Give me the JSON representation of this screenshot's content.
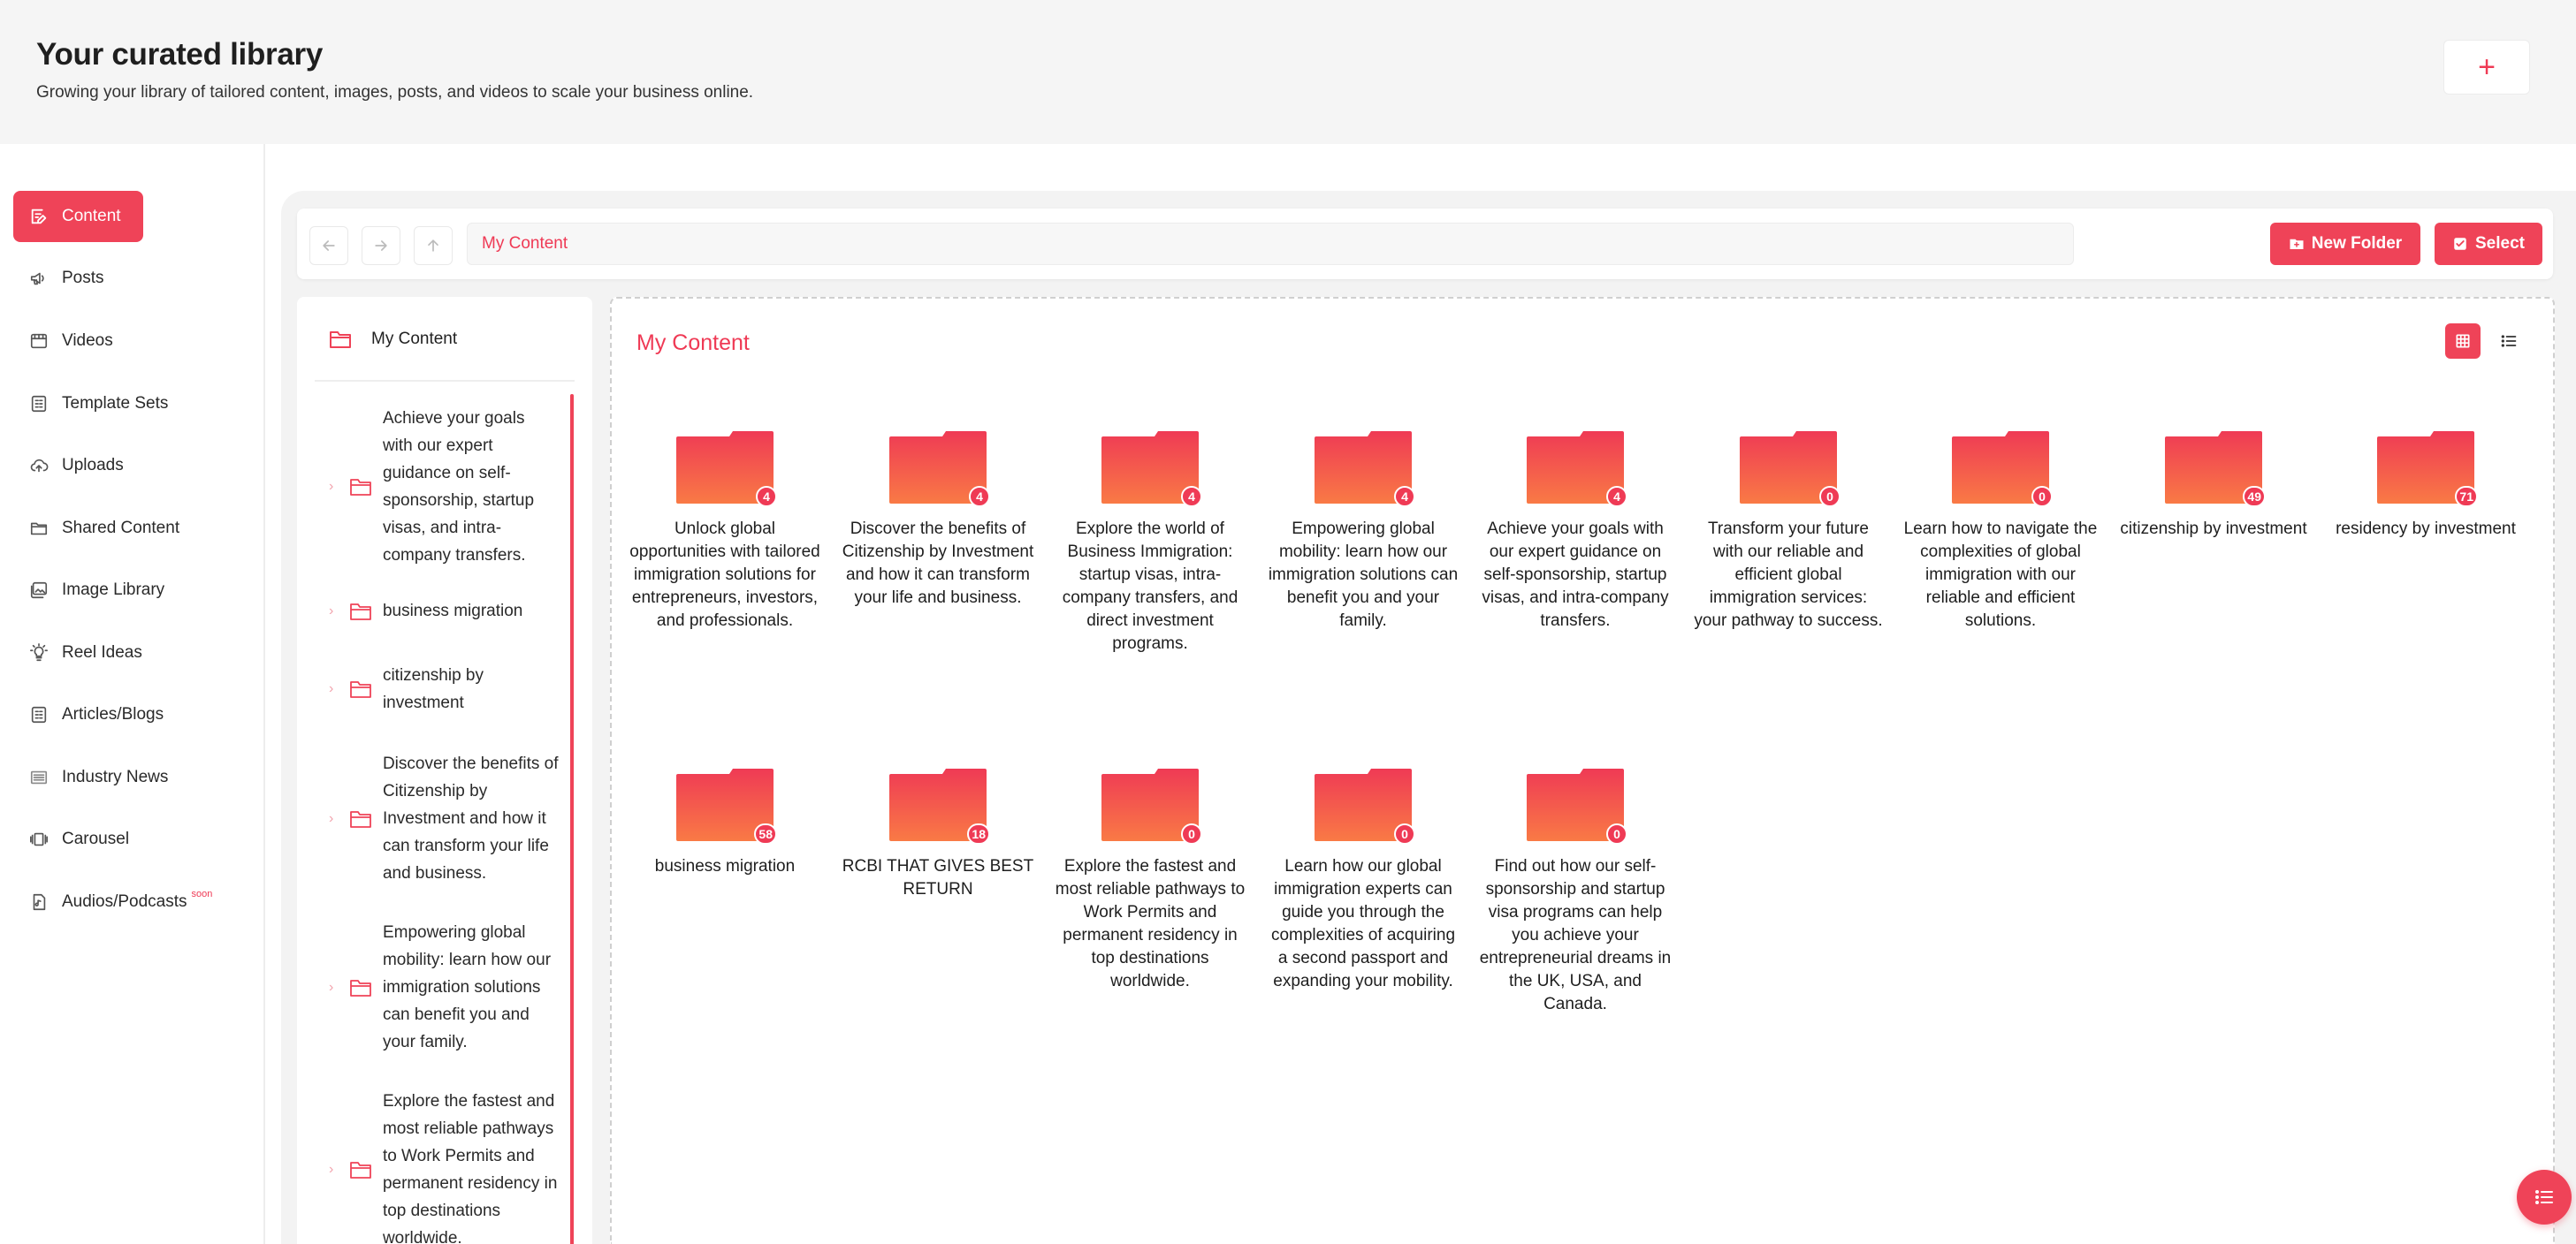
{
  "header": {
    "title": "Your curated library",
    "subtitle": "Growing your library of tailored content, images, posts, and videos to scale your business online.",
    "add_label": "+"
  },
  "sidebar": {
    "items": [
      {
        "label": "Content",
        "icon": "content-icon",
        "active": true
      },
      {
        "label": "Posts",
        "icon": "megaphone-icon"
      },
      {
        "label": "Videos",
        "icon": "video-icon"
      },
      {
        "label": "Template Sets",
        "icon": "template-icon"
      },
      {
        "label": "Uploads",
        "icon": "upload-icon"
      },
      {
        "label": "Shared Content",
        "icon": "folder-icon"
      },
      {
        "label": "Image Library",
        "icon": "image-icon"
      },
      {
        "label": "Reel Ideas",
        "icon": "lightbulb-icon"
      },
      {
        "label": "Articles/Blogs",
        "icon": "article-icon"
      },
      {
        "label": "Industry News",
        "icon": "newspaper-icon"
      },
      {
        "label": "Carousel",
        "icon": "carousel-icon"
      },
      {
        "label": "Audios/Podcasts",
        "icon": "audio-icon",
        "badge": "soon"
      }
    ]
  },
  "toolbar": {
    "path": "My Content",
    "new_folder_label": "New Folder",
    "select_label": "Select"
  },
  "tree": {
    "root_label": "My Content",
    "items": [
      "Achieve your goals with our expert guidance on self-sponsorship, startup visas, and intra-company transfers.",
      "business migration",
      "citizenship by investment",
      "Discover the benefits of Citizenship by Investment and how it can transform your life and business.",
      "Empowering global mobility: learn how our immigration solutions can benefit you and your family.",
      "Explore the fastest and most reliable pathways to Work Permits and permanent residency in top destinations worldwide."
    ]
  },
  "content": {
    "title": "My Content",
    "folders": [
      {
        "label": "Unlock global opportunities with tailored immigration solutions for entrepreneurs, investors, and professionals.",
        "count": "4"
      },
      {
        "label": "Discover the benefits of Citizenship by Investment and how it can transform your life and business.",
        "count": "4"
      },
      {
        "label": "Explore the world of Business Immigration: startup visas, intra-company transfers, and direct investment programs.",
        "count": "4"
      },
      {
        "label": "Empowering global mobility: learn how our immigration solutions can benefit you and your family.",
        "count": "4"
      },
      {
        "label": "Achieve your goals with our expert guidance on self-sponsorship, startup visas, and intra-company transfers.",
        "count": "4"
      },
      {
        "label": "Transform your future with our reliable and efficient global immigration services: your pathway to success.",
        "count": "0"
      },
      {
        "label": "Learn how to navigate the complexities of global immigration with our reliable and efficient solutions.",
        "count": "0"
      },
      {
        "label": "citizenship by investment",
        "count": "49"
      },
      {
        "label": "residency by investment",
        "count": "71"
      },
      {
        "label": "business migration",
        "count": "58"
      },
      {
        "label": "RCBI THAT GIVES BEST RETURN",
        "count": "18"
      },
      {
        "label": "Explore the fastest and most reliable pathways to Work Permits and permanent residency in top destinations worldwide.",
        "count": "0"
      },
      {
        "label": "Learn how our global immigration experts can guide you through the complexities of acquiring a second passport and expanding your mobility.",
        "count": "0"
      },
      {
        "label": "Find out how our self-sponsorship and startup visa programs can help you achieve your entrepreneurial dreams in the UK, USA, and Canada.",
        "count": "0"
      }
    ]
  },
  "colors": {
    "accent": "#ef4358",
    "folder_top": "#ef3a55",
    "folder_bottom": "#f97a45"
  }
}
